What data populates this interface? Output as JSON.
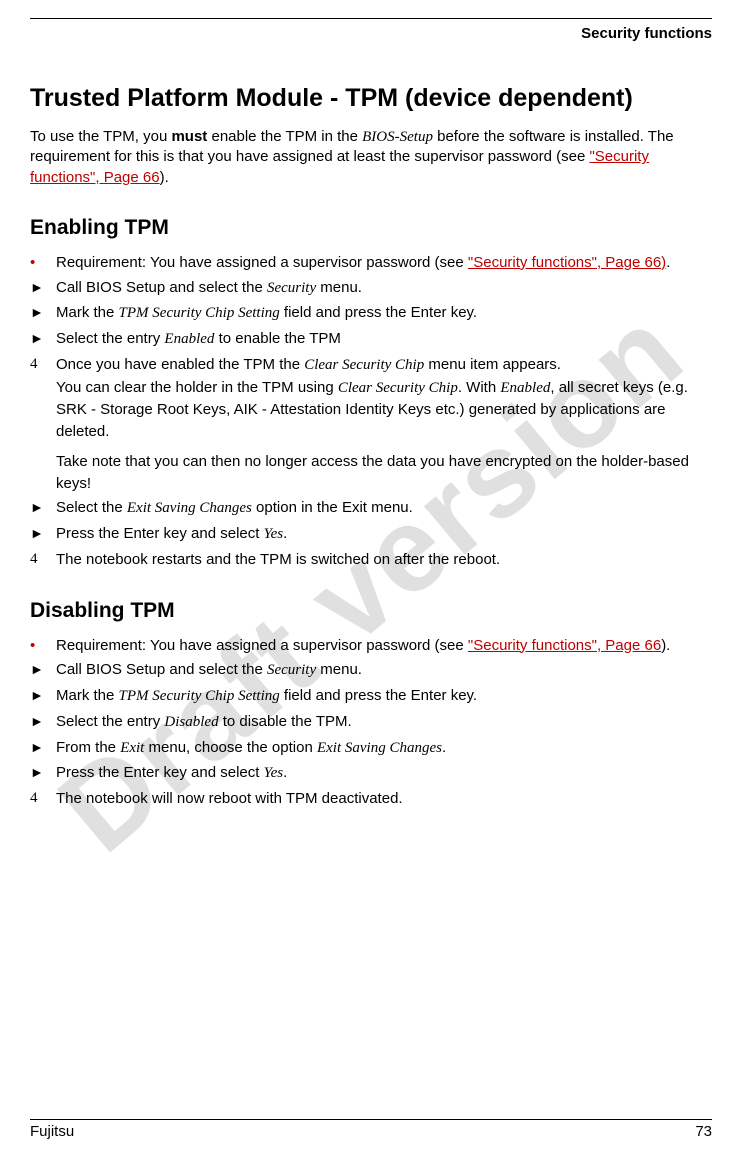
{
  "watermark": "Draft version",
  "header_section": "Security functions",
  "title": "Trusted Platform Module - TPM (device dependent)",
  "intro": {
    "t1": "To use the TPM, you ",
    "must": "must",
    "t2": " enable the TPM in the ",
    "bios": "BIOS-Setup",
    "t3": " before the software is installed. The requirement for this is that you have assigned at least the supervisor password (see ",
    "link": "\"Security functions\", Page 66",
    "t4": ")."
  },
  "enable": {
    "heading": "Enabling TPM",
    "req_pre": "Requirement: You have assigned a supervisor password (see ",
    "req_link": "\"Security functions\", Page 66)",
    "req_post": ".",
    "s1a": "Call BIOS Setup and select the ",
    "s1i": "Security",
    "s1b": " menu.",
    "s2a": "Mark the ",
    "s2i": "TPM Security Chip Setting",
    "s2b": " field and press the Enter key.",
    "s3a": "Select the entry ",
    "s3i": "Enabled",
    "s3b": " to enable the TPM",
    "r1a": "Once you have enabled the TPM the ",
    "r1i": "Clear Security Chip",
    "r1b": " menu item appears.",
    "r2a": "You can clear the holder in the TPM using ",
    "r2i": "Clear Security Chip",
    "r2b": ". With ",
    "r2i2": "Enabled",
    "r2c": ", all secret keys (e.g. SRK - Storage Root Keys, AIK - Attestation Identity Keys etc.) generated by applications are deleted.",
    "r3": "Take note that you can then no longer access the data you have encrypted on the holder-based keys!",
    "s4a": "Select the ",
    "s4i": "Exit Saving Changes",
    "s4b": " option in the Exit menu.",
    "s5a": "Press the Enter key and select ",
    "s5i": "Yes",
    "s5b": ".",
    "r4": "The notebook restarts and the TPM is switched on after the reboot."
  },
  "disable": {
    "heading": "Disabling TPM",
    "req_pre": "Requirement: You have assigned a supervisor password (see ",
    "req_link": "\"Security functions\", Page 66",
    "req_post": ").",
    "s1a": "Call BIOS Setup and select the ",
    "s1i": "Security",
    "s1b": " menu.",
    "s2a": "Mark the ",
    "s2i": "TPM Security Chip Setting",
    "s2b": " field and press the Enter key.",
    "s3a": "Select the entry ",
    "s3i": "Disabled",
    "s3b": " to disable the TPM.",
    "s4a": "From the ",
    "s4i": "Exit",
    "s4b": " menu, choose the option ",
    "s4i2": "Exit Saving Changes",
    "s4c": ".",
    "s5a": "Press the Enter key and select ",
    "s5i": "Yes",
    "s5b": ".",
    "r1": "The notebook will now reboot with TPM deactivated."
  },
  "marks": {
    "dot": "•",
    "tri": "►",
    "num": "4"
  },
  "footer": {
    "brand": "Fujitsu",
    "page": "73"
  }
}
